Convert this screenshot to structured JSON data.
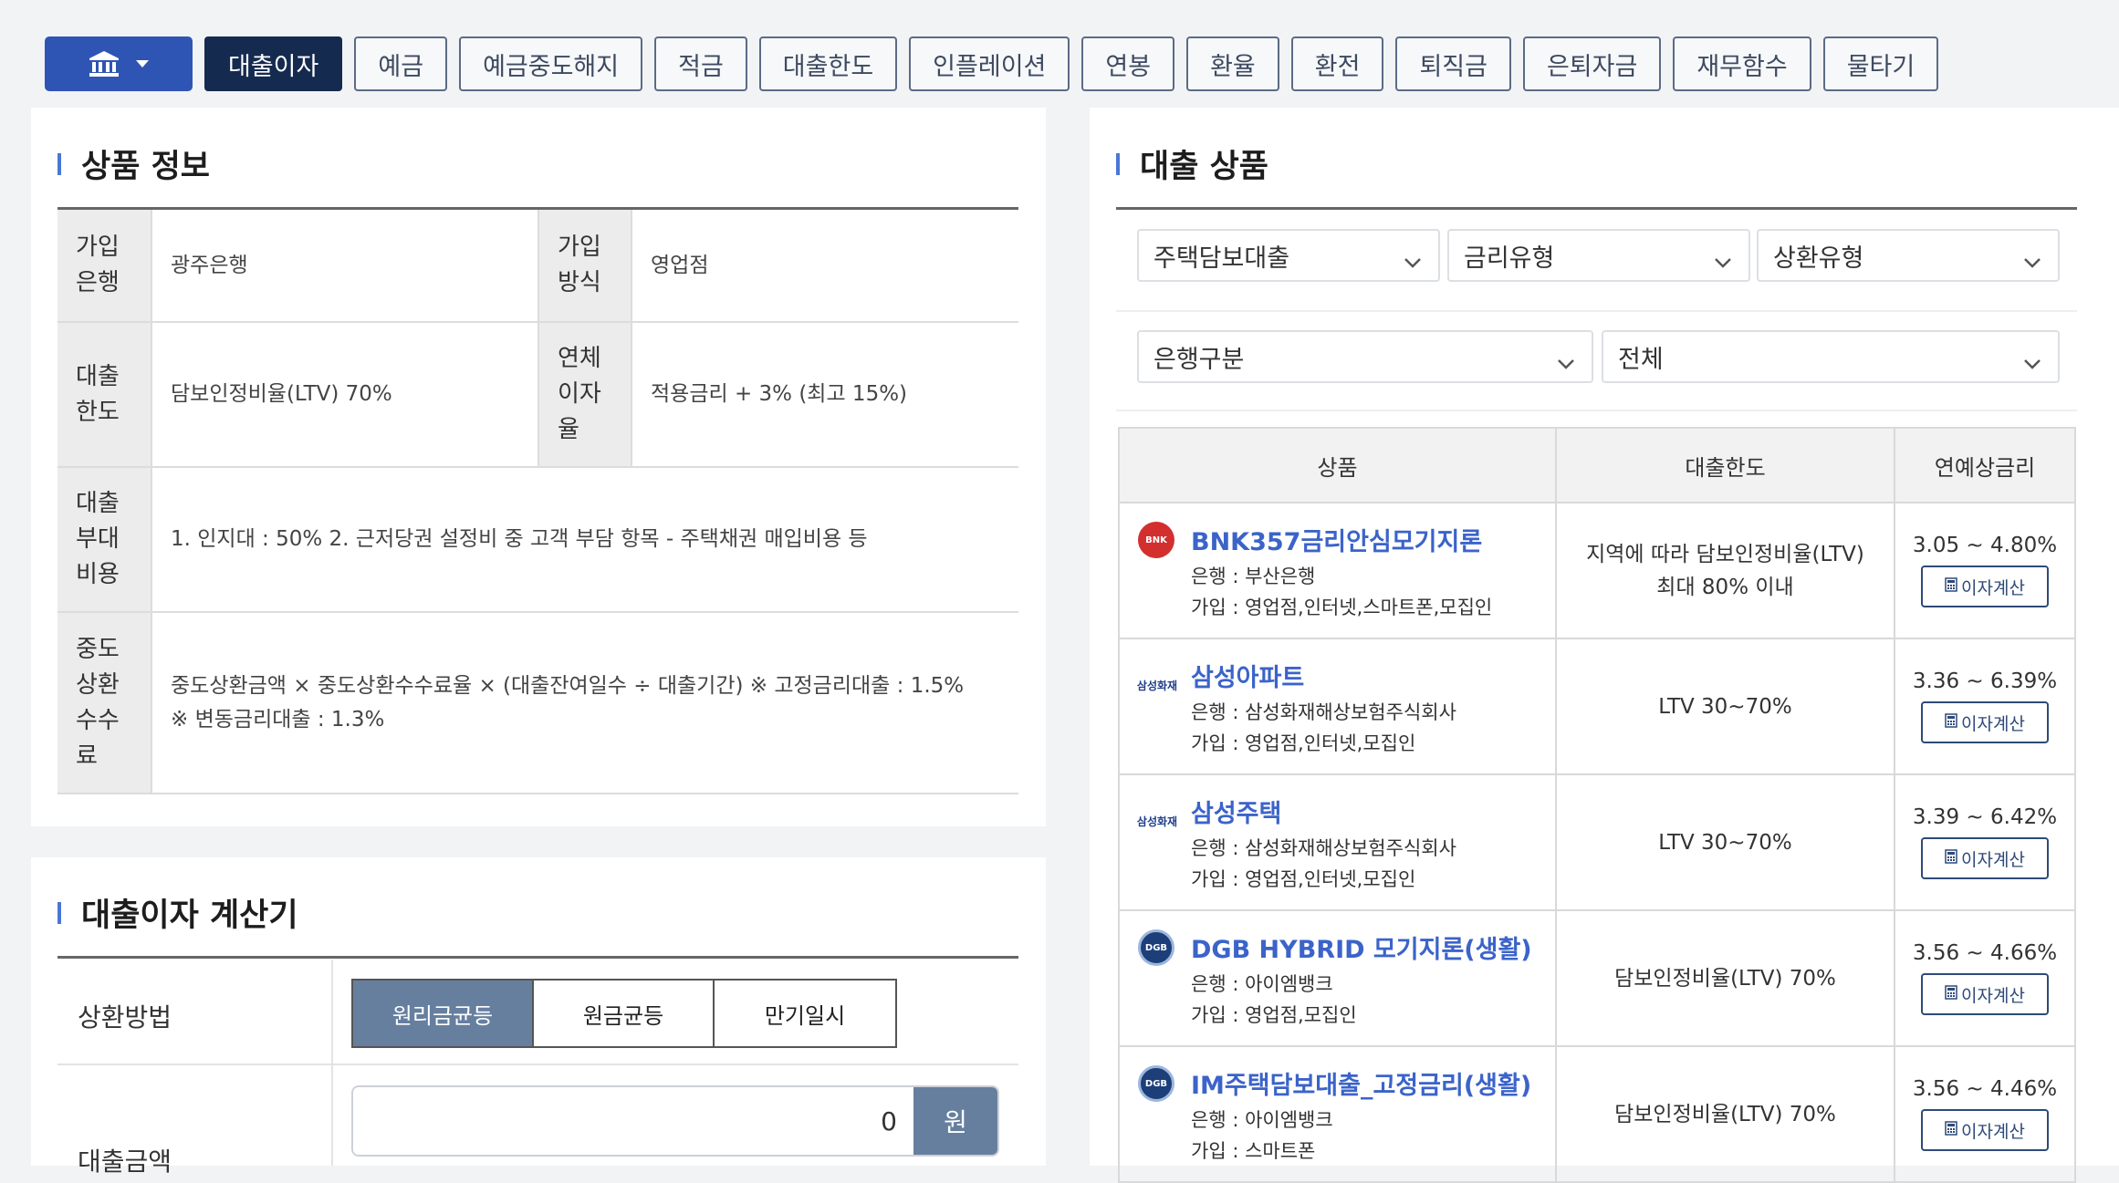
{
  "tabs": [
    "대출이자",
    "예금",
    "예금중도해지",
    "적금",
    "대출한도",
    "인플레이션",
    "연봉",
    "환율",
    "환전",
    "퇴직금",
    "은퇴자금",
    "재무함수",
    "물타기"
  ],
  "product_info": {
    "title": "상품 정보",
    "rows": [
      {
        "l1": "가입\n은행",
        "v1": "광주은행",
        "l2": "가입\n방식",
        "v2": "영업점"
      },
      {
        "l1": "대출\n한도",
        "v1": "담보인정비율(LTV) 70%",
        "l2": "연체\n이자\n율",
        "v2": "적용금리 + 3% (최고 15%)"
      },
      {
        "l1": "대출\n부대\n비용",
        "v1": "1. 인지대 : 50% 2. 근저당권 설정비 중 고객 부담 항목 - 주택채권 매입비용 등"
      },
      {
        "l1": "중도\n상환\n수수\n료",
        "v1": "중도상환금액 × 중도상환수수료율 × (대출잔여일수 ÷ 대출기간) ※ 고정금리대출 : 1.5%\n※ 변동금리대출 : 1.3%"
      }
    ]
  },
  "calculator": {
    "title": "대출이자 계산기",
    "method_label": "상환방법",
    "methods": [
      "원리금균등",
      "원금균등",
      "만기일시"
    ],
    "amount_label": "대출금액",
    "amount_value": "0",
    "won": "원"
  },
  "loans": {
    "title": "대출 상품",
    "filters": {
      "type": "주택담보대출",
      "rate": "금리유형",
      "repay": "상환유형",
      "bank": "은행구분",
      "all": "전체"
    },
    "headers": [
      "상품",
      "대출한도",
      "연예상금리"
    ],
    "calc_label": "이자계산",
    "items": [
      {
        "logo": "BNK",
        "name": "BNK357금리안심모기지론",
        "bank": "은행 : 부산은행",
        "join": "가입 : 영업점,인터넷,스마트폰,모집인",
        "limit1": "지역에 따라 담보인정비율(LTV)",
        "limit2": "최대 80% 이내",
        "rate": "3.05 ~ 4.80%"
      },
      {
        "logo": "삼성화재",
        "name": "삼성아파트",
        "bank": "은행 : 삼성화재해상보험주식회사",
        "join": "가입 : 영업점,인터넷,모집인",
        "limit1": "LTV 30~70%",
        "limit2": "",
        "rate": "3.36 ~ 6.39%"
      },
      {
        "logo": "삼성화재",
        "name": "삼성주택",
        "bank": "은행 : 삼성화재해상보험주식회사",
        "join": "가입 : 영업점,인터넷,모집인",
        "limit1": "LTV 30~70%",
        "limit2": "",
        "rate": "3.39 ~ 6.42%"
      },
      {
        "logo": "DGB",
        "name": "DGB HYBRID 모기지론(생활)",
        "bank": "은행 : 아이엠뱅크",
        "join": "가입 : 영업점,모집인",
        "limit1": "담보인정비율(LTV) 70%",
        "limit2": "",
        "rate": "3.56 ~ 4.66%"
      },
      {
        "logo": "DGB",
        "name": "IM주택담보대출_고정금리(생활)",
        "bank": "은행 : 아이엠뱅크",
        "join": "가입 : 스마트폰",
        "limit1": "담보인정비율(LTV) 70%",
        "limit2": "",
        "rate": "3.56 ~ 4.46%"
      }
    ]
  }
}
